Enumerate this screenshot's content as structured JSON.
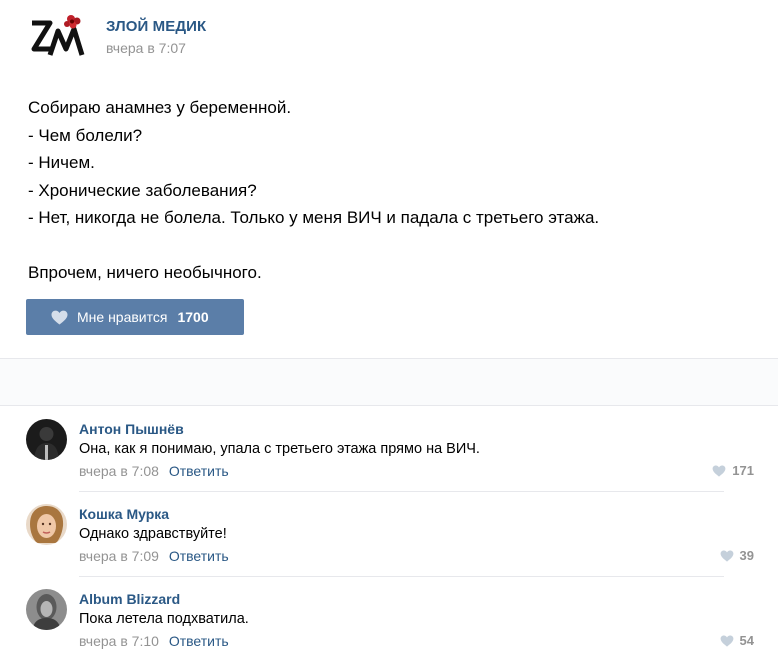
{
  "post": {
    "author": "ЗЛОЙ МЕДИК",
    "time": "вчера в 7:07",
    "lines": [
      "Собираю анамнез у беременной.",
      "- Чем болели?",
      "- Ничем.",
      "- Хронические заболевания?",
      "- Нет, никогда не болела. Только у меня ВИЧ и падала с третьего этажа.",
      "",
      "Впрочем, ничего необычного."
    ],
    "like_label": "Мне нравится",
    "like_count": "1700",
    "icons": {
      "logo": "zm-logo-icon",
      "like": "heart-icon"
    },
    "colors": {
      "accent": "#2a5885",
      "like_button": "#5b7ea8",
      "meta": "#939393"
    }
  },
  "comments": [
    {
      "name": "Антон Пышнёв",
      "text": "Она, как я понимаю, упала с третьего этажа прямо на ВИЧ.",
      "time": "вчера в 7:08",
      "reply": "Ответить",
      "likes": "171"
    },
    {
      "name": "Кошка Мурка",
      "text": "Однако здравствуйте!",
      "time": "вчера в 7:09",
      "reply": "Ответить",
      "likes": "39"
    },
    {
      "name": "Album Blizzard",
      "text": "Пока летела подхватила.",
      "time": "вчера в 7:10",
      "reply": "Ответить",
      "likes": "54"
    }
  ]
}
